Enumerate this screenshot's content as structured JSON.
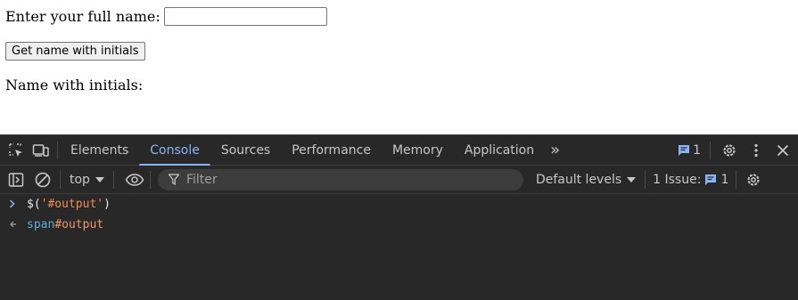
{
  "page": {
    "name_label": "Enter your full name:",
    "name_value": "",
    "button_label": "Get name with initials",
    "result_label": "Name with initials:"
  },
  "devtools": {
    "tabs": [
      "Elements",
      "Console",
      "Sources",
      "Performance",
      "Memory",
      "Application"
    ],
    "active_tab": "Console",
    "messages_count": "1",
    "toolbar": {
      "context": "top",
      "filter_placeholder": "Filter",
      "levels": "Default levels",
      "issues_label": "1 Issue:",
      "issues_count": "1"
    },
    "console_lines": [
      {
        "type": "input",
        "prefix": "$(",
        "string": "'#output'",
        "suffix": ")"
      },
      {
        "type": "result",
        "tag": "span",
        "id": "#output"
      }
    ],
    "colors": {
      "accent": "#8ab4f8",
      "panel_bg": "#282828",
      "string": "#f28b54",
      "tag": "#5db0d7"
    }
  }
}
